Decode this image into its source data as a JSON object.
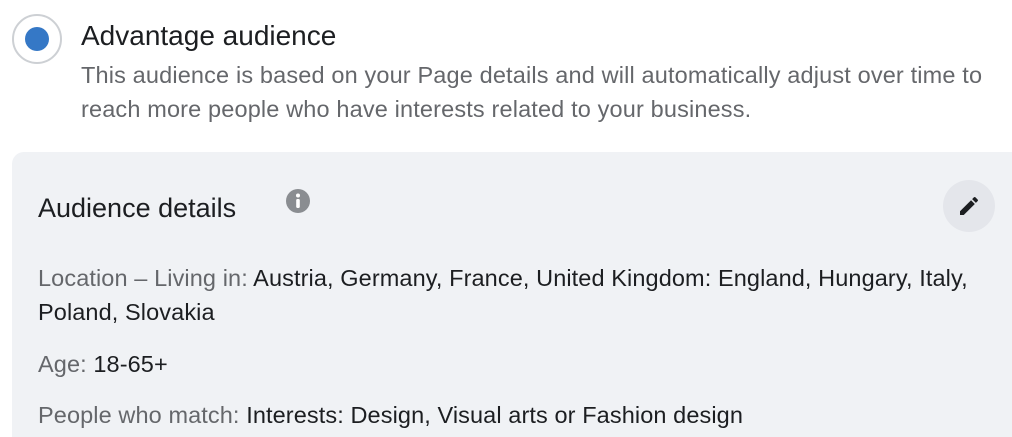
{
  "audience_option": {
    "title": "Advantage audience",
    "selected": true,
    "description": "This audience is based on your Page details and will automatically adjust over time to reach more people who have interests related to your business.",
    "accent_color": "#3578c6"
  },
  "audience_details": {
    "title": "Audience details",
    "info_icon": "info-icon",
    "edit_icon": "pencil-icon",
    "location": {
      "label": "Location – Living in: ",
      "value": "Austria, Germany, France, United Kingdom: England, Hungary, Italy, Poland, Slovakia"
    },
    "age": {
      "label": "Age: ",
      "value": "18-65+"
    },
    "match": {
      "label": "People who match: ",
      "value": "Interests: Design, Visual arts or Fashion design"
    }
  }
}
